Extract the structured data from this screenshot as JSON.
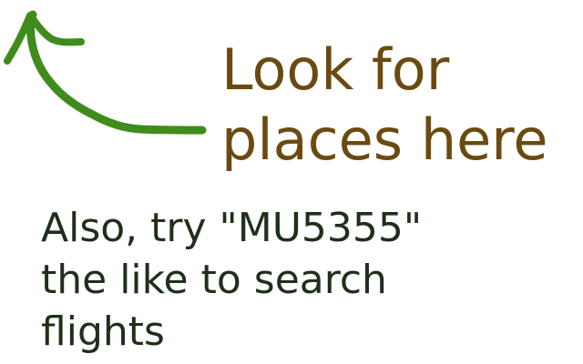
{
  "colors": {
    "arrow": "#3f8c1d",
    "headline": "#6b4a10",
    "hint": "#1f2f19",
    "background": "#ffffff"
  },
  "arrow": {
    "icon": "hand-drawn-arrow-up-left-icon"
  },
  "headline": {
    "lines": [
      "Look for",
      "places here"
    ]
  },
  "hint": {
    "lines": [
      "Also, try \"MU5355\"",
      "the like to search",
      "flights"
    ]
  }
}
